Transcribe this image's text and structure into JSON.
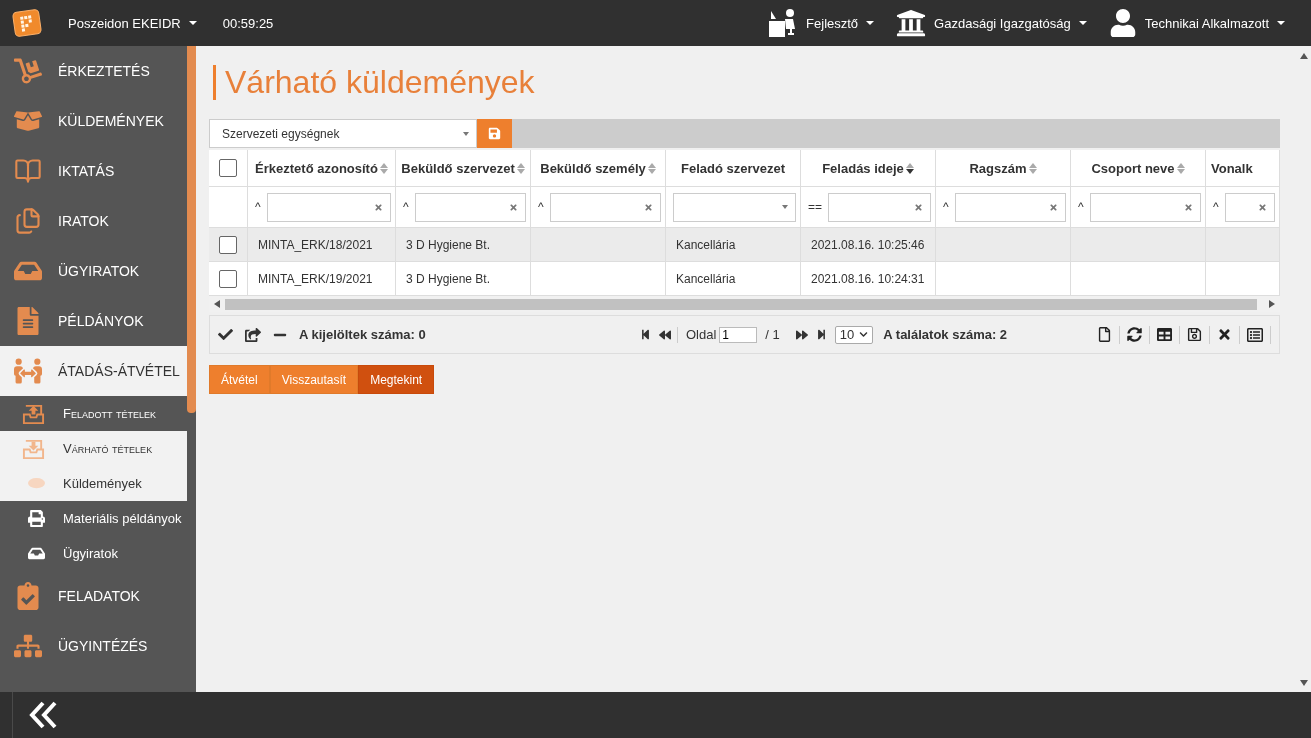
{
  "top_bar": {
    "app_name": "Poszeidon EKEIDR",
    "timer": "00:59:25",
    "user_menus": [
      {
        "label": "Fejlesztő"
      },
      {
        "label": "Gazdasági Igazgatóság"
      },
      {
        "label": "Technikai Alkalmazott"
      }
    ]
  },
  "sidebar": {
    "items": [
      {
        "label": "ÉRKEZTETÉS",
        "selected": false
      },
      {
        "label": "KÜLDEMÉNYEK",
        "selected": false
      },
      {
        "label": "IKTATÁS",
        "selected": false
      },
      {
        "label": "IRATOK",
        "selected": false
      },
      {
        "label": "ÜGYIRATOK",
        "selected": false
      },
      {
        "label": "PÉLDÁNYOK",
        "selected": false
      },
      {
        "label": "ÁTADÁS-ÁTVÉTEL",
        "selected": true,
        "children": [
          {
            "label": "Feladott tételek",
            "selected": false
          },
          {
            "label": "Várható tételek",
            "selected": true,
            "children": [
              {
                "label": "Küldemények",
                "selected": true
              },
              {
                "label": "Materiális példányok",
                "selected": false
              },
              {
                "label": "Ügyiratok",
                "selected": false
              }
            ]
          }
        ]
      },
      {
        "label": "FELADATOK",
        "selected": false
      },
      {
        "label": "ÜGYINTÉZÉS",
        "selected": false
      }
    ]
  },
  "page": {
    "title": "Várható küldemények"
  },
  "toolbar": {
    "view_select": {
      "value": "Szervezeti egységnek"
    }
  },
  "table": {
    "select_all": {
      "checked": false
    },
    "columns": [
      {
        "label": "Érkeztető azonosító",
        "sorted": false,
        "filter": {
          "kind": "text",
          "operator": "^"
        }
      },
      {
        "label": "Beküldő szervezet",
        "sorted": false,
        "filter": {
          "kind": "text",
          "operator": "^"
        }
      },
      {
        "label": "Beküldő személy",
        "sorted": false,
        "filter": {
          "kind": "text",
          "operator": "^"
        }
      },
      {
        "label": "Feladó szervezet",
        "filter": {
          "kind": "select"
        }
      },
      {
        "label": "Feladás ideje",
        "sorted": true,
        "filter": {
          "kind": "text",
          "operator": "=="
        }
      },
      {
        "label": "Ragszám",
        "sorted": false,
        "filter": {
          "kind": "text",
          "operator": "^"
        }
      },
      {
        "label": "Csoport neve",
        "sorted": false,
        "filter": {
          "kind": "text",
          "operator": "^"
        }
      },
      {
        "label": "Vonalk",
        "filter": {
          "kind": "text",
          "operator": "^"
        }
      }
    ],
    "rows": [
      {
        "checked": false,
        "cells": [
          "MINTA_ERK/18/2021",
          "3 D Hygiene Bt.",
          null,
          "Kancellária",
          "2021.08.16. 10:25:46",
          null,
          null,
          null
        ]
      },
      {
        "checked": false,
        "cells": [
          "MINTA_ERK/19/2021",
          "3 D Hygiene Bt.",
          null,
          "Kancellária",
          "2021.08.16. 10:24:31",
          null,
          null,
          null
        ]
      }
    ]
  },
  "footer": {
    "selected_count": "A kijelöltek száma: 0",
    "page_label": "Oldal",
    "page": "1",
    "page_total": "/ 1",
    "page_size": "10",
    "result_count": "A találatok száma: 2"
  },
  "actions": [
    {
      "label": "Átvétel",
      "kind": "normal"
    },
    {
      "label": "Visszautasít",
      "kind": "normal"
    },
    {
      "label": "Megtekint",
      "kind": "primary"
    }
  ]
}
